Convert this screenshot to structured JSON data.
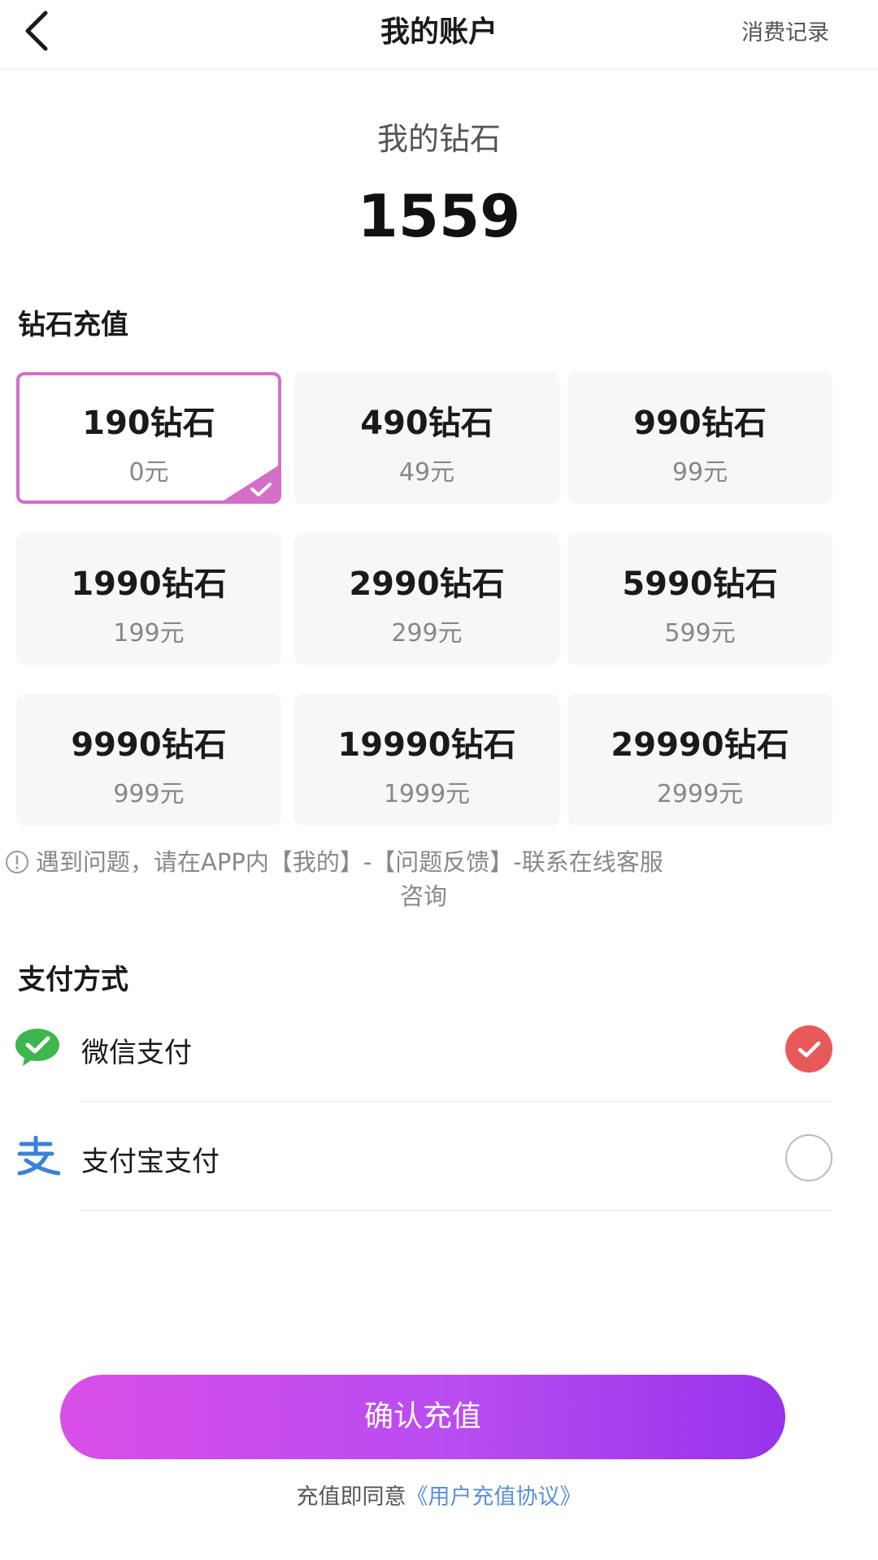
{
  "header": {
    "title": "我的账户",
    "right_link": "消费记录",
    "back_icon": "chevron-left-icon"
  },
  "balance": {
    "label": "我的钻石",
    "value": "1559"
  },
  "recharge": {
    "section_title": "钻石充值",
    "selected_index": 0,
    "packages": [
      {
        "amount": "190钻石",
        "price": "0元"
      },
      {
        "amount": "490钻石",
        "price": "49元"
      },
      {
        "amount": "990钻石",
        "price": "99元"
      },
      {
        "amount": "1990钻石",
        "price": "199元"
      },
      {
        "amount": "2990钻石",
        "price": "299元"
      },
      {
        "amount": "5990钻石",
        "price": "599元"
      },
      {
        "amount": "9990钻石",
        "price": "999元"
      },
      {
        "amount": "19990钻石",
        "price": "1999元"
      },
      {
        "amount": "29990钻石",
        "price": "2999元"
      }
    ]
  },
  "notice": {
    "line1": "遇到问题，请在APP内【我的】-【问题反馈】-联系在线客服",
    "line2": "咨询",
    "icon": "info-icon"
  },
  "payment": {
    "section_title": "支付方式",
    "methods": [
      {
        "label": "微信支付",
        "icon": "wechat-pay-icon",
        "selected": true
      },
      {
        "label": "支付宝支付",
        "icon": "alipay-icon",
        "selected": false
      }
    ]
  },
  "confirm": {
    "label": "确认充值"
  },
  "agreement": {
    "prefix": "充值即同意",
    "link": "《用户充值协议》"
  },
  "colors": {
    "selected_border": "#d46ec6",
    "radio_selected": "#e85a5a",
    "button_gradient_start": "#d94ee8",
    "button_gradient_end": "#9733ea",
    "link": "#5b8fdc",
    "wechat_green": "#3fb54e",
    "alipay_blue": "#3b82d6"
  }
}
